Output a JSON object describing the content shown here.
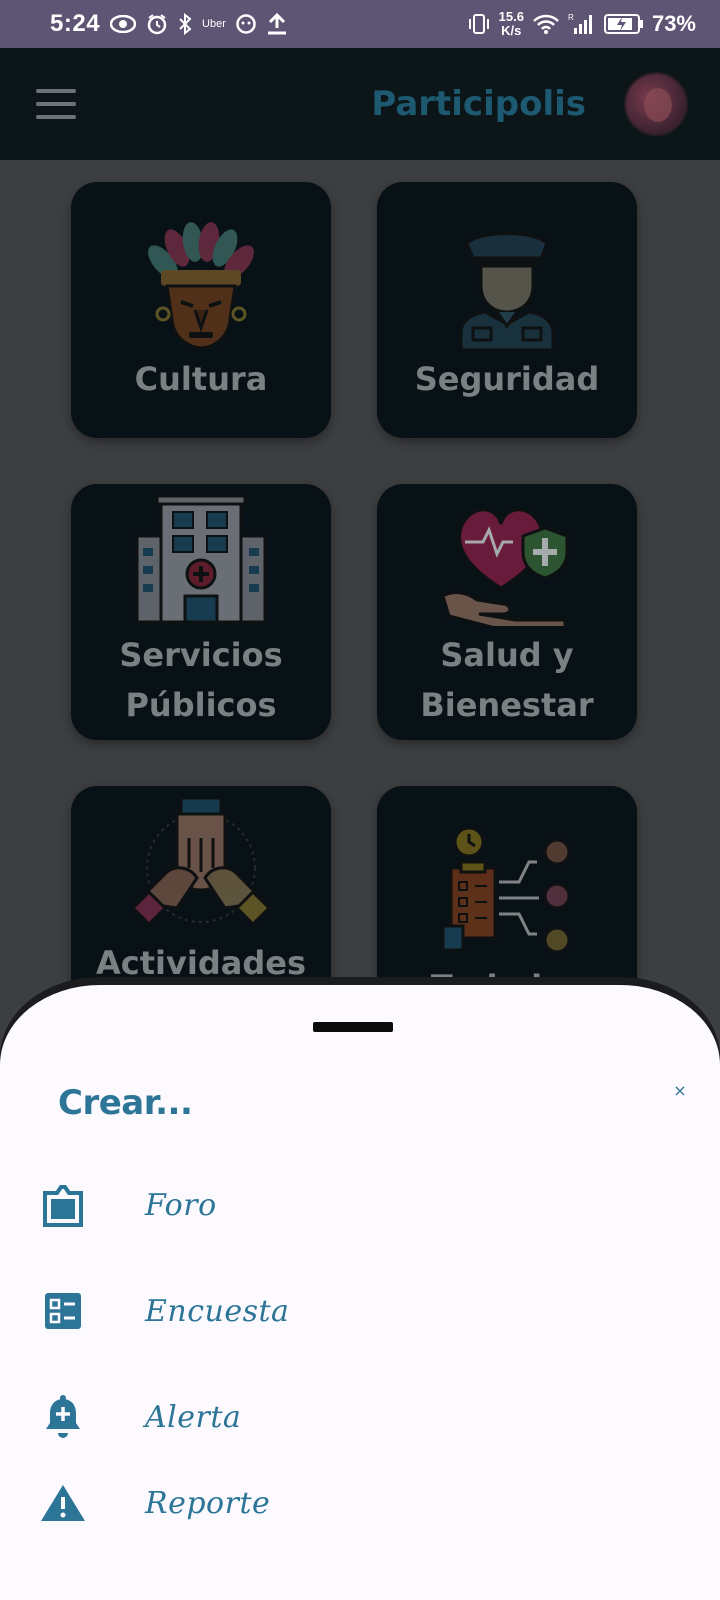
{
  "status_bar": {
    "time": "5:24",
    "carrier_badge": "Uber",
    "net_speed_value": "15.6",
    "net_speed_unit": "K/s",
    "signal_badge": "R",
    "battery_percent": "73%"
  },
  "app_bar": {
    "title": "Participolis"
  },
  "categories": [
    {
      "label_1": "Cultura",
      "label_2": "",
      "icon": "tribal-mask-icon"
    },
    {
      "label_1": "Seguridad",
      "label_2": "",
      "icon": "police-officer-icon"
    },
    {
      "label_1": "Servicios",
      "label_2": "Públicos",
      "icon": "hospital-building-icon"
    },
    {
      "label_1": "Salud y",
      "label_2": "Bienestar",
      "icon": "heart-in-hand-icon"
    },
    {
      "label_1": "Actividades",
      "label_2": "",
      "icon": "hands-together-icon"
    },
    {
      "label_1": "Trabajos",
      "label_2": "",
      "icon": "job-assignment-icon"
    }
  ],
  "sheet": {
    "title": "Crear...",
    "close_label": "×",
    "options": [
      {
        "label": "Foro",
        "icon": "forum-icon"
      },
      {
        "label": "Encuesta",
        "icon": "survey-list-icon"
      },
      {
        "label": "Alerta",
        "icon": "bell-plus-icon"
      },
      {
        "label": "Reporte",
        "icon": "warning-triangle-icon"
      }
    ]
  },
  "colors": {
    "status_bar_bg": "#5e5473",
    "app_bar_bg": "#0c1518",
    "accent": "#2c7597",
    "card_bg": "#081216",
    "sheet_bg": "#fcfaff"
  }
}
